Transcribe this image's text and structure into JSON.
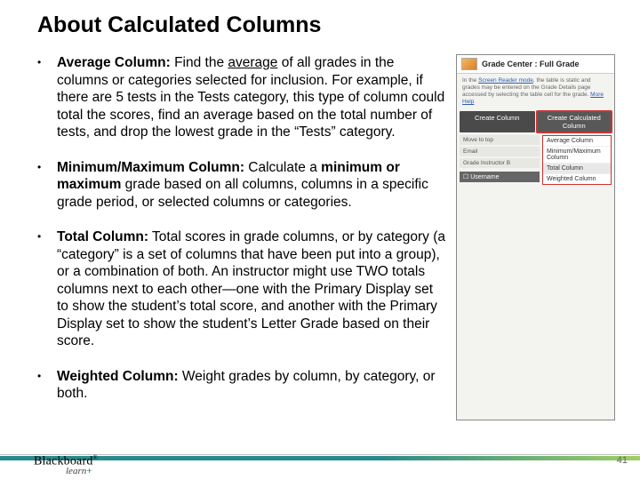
{
  "title": "About Calculated Columns",
  "bullets": [
    {
      "label": "Average Column:",
      "lead": "  Find the ",
      "underlined": "average",
      "rest": " of all grades in the columns or categories selected for inclusion.  For example, if there are 5 tests in the Tests category, this type of column could total the scores, find an average based on the total number of tests, and drop the lowest grade in the “Tests” category."
    },
    {
      "label": "Minimum/Maximum Column:",
      "lead": " Calculate a ",
      "bold2": "minimum or maximum",
      "rest": " grade based on all columns, columns in a specific grade period, or selected columns or categories."
    },
    {
      "label": "Total Column:",
      "rest": "  Total scores in grade columns, or by category (a “category” is a set of columns that have been put into a group), or a combination of both. An instructor might use TWO totals columns next to each other—one with the Primary Display set to show the student’s total score, and another with the Primary Display set to show the student’s Letter Grade based on their score."
    },
    {
      "label": "Weighted Column:",
      "rest": "  Weight grades by column, by category, or both."
    }
  ],
  "screenshot": {
    "header": "Grade Center : Full Grade",
    "blurb_prefix": "In the ",
    "blurb_link": "Screen Reader mode",
    "blurb_rest": ", the table is static and grades may be entered on the Grade Details page accessed by selecting the table cell for the grade. ",
    "blurb_more": "More Help",
    "btn_create": "Create Column",
    "btn_calc": "Create Calculated Column",
    "side": [
      "Move to top",
      "Email",
      "Grade Instructor B"
    ],
    "username": "Username",
    "menu": [
      "Average Column",
      "Minimum/Maximum Column",
      "Total Column",
      "Weighted Column"
    ]
  },
  "logo": {
    "main": "Blackboard",
    "sub": "learn",
    "tm": "®"
  },
  "page": "41"
}
